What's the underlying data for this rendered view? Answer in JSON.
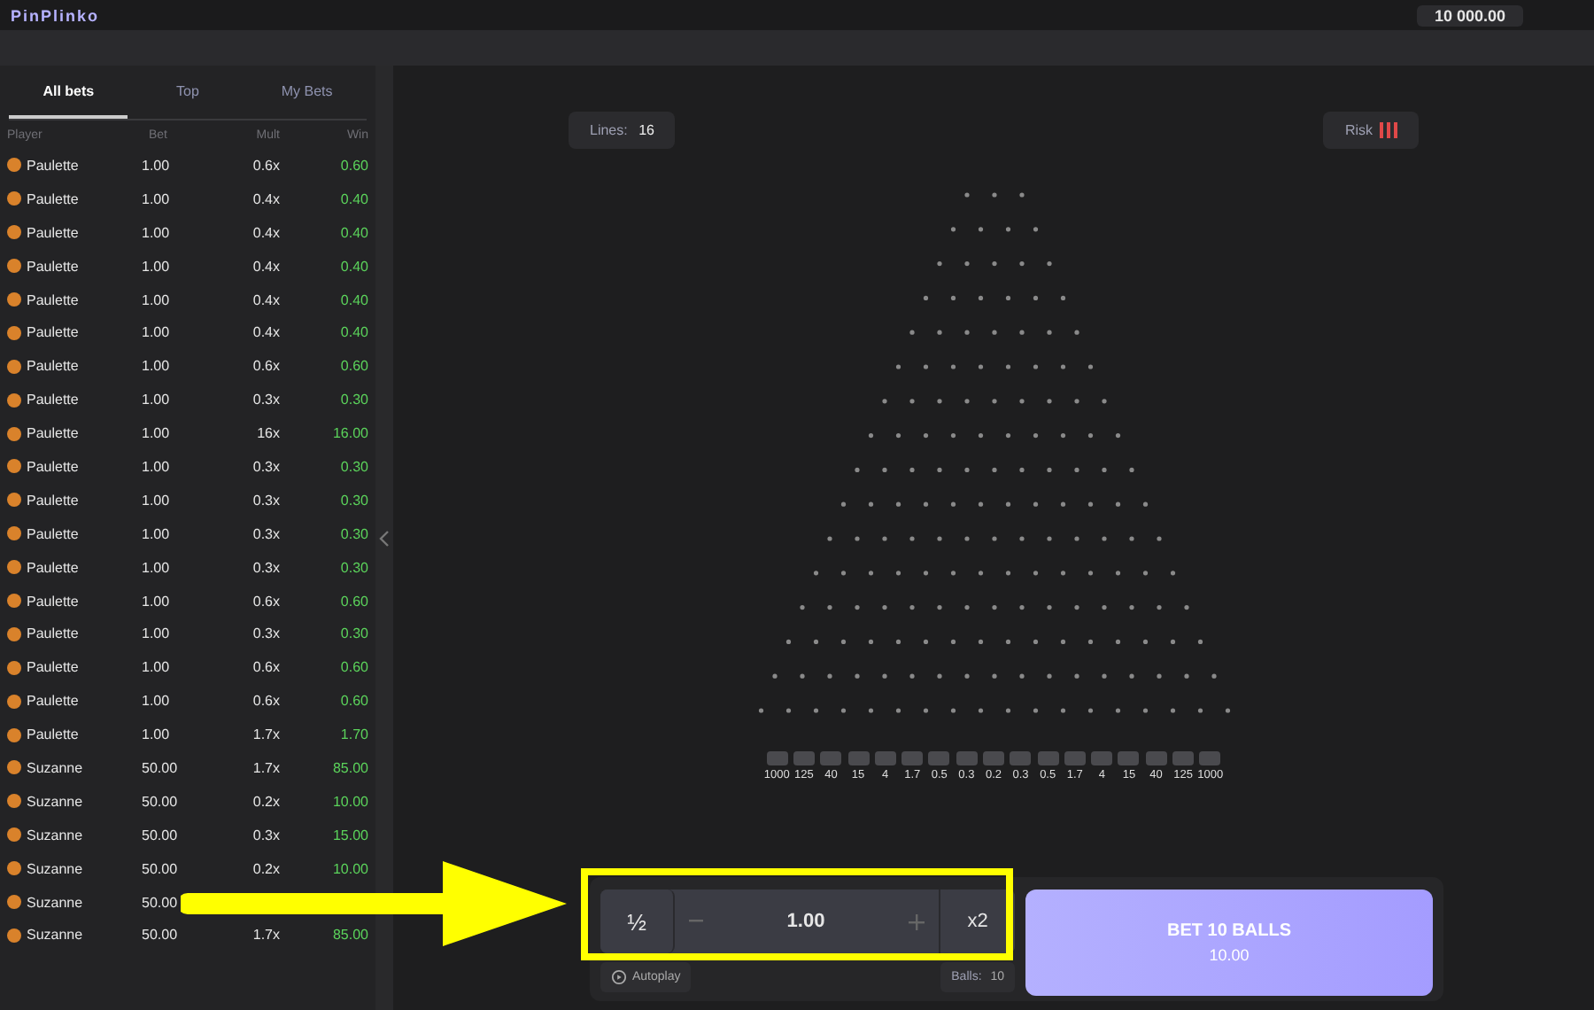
{
  "header": {
    "logo": "PinPlinko",
    "balance": "10 000.00"
  },
  "sidebar": {
    "tabs": [
      {
        "label": "All bets",
        "selected": true
      },
      {
        "label": "Top",
        "selected": false
      },
      {
        "label": "My Bets",
        "selected": false
      }
    ],
    "columns": [
      "Player",
      "Bet",
      "Mult",
      "Win"
    ],
    "rows": [
      {
        "player": "Paulette",
        "bet": "1.00",
        "mult": "0.6x",
        "win": "0.60"
      },
      {
        "player": "Paulette",
        "bet": "1.00",
        "mult": "0.4x",
        "win": "0.40"
      },
      {
        "player": "Paulette",
        "bet": "1.00",
        "mult": "0.4x",
        "win": "0.40"
      },
      {
        "player": "Paulette",
        "bet": "1.00",
        "mult": "0.4x",
        "win": "0.40"
      },
      {
        "player": "Paulette",
        "bet": "1.00",
        "mult": "0.4x",
        "win": "0.40"
      },
      {
        "player": "Paulette",
        "bet": "1.00",
        "mult": "0.4x",
        "win": "0.40"
      },
      {
        "player": "Paulette",
        "bet": "1.00",
        "mult": "0.6x",
        "win": "0.60"
      },
      {
        "player": "Paulette",
        "bet": "1.00",
        "mult": "0.3x",
        "win": "0.30"
      },
      {
        "player": "Paulette",
        "bet": "1.00",
        "mult": "16x",
        "win": "16.00"
      },
      {
        "player": "Paulette",
        "bet": "1.00",
        "mult": "0.3x",
        "win": "0.30"
      },
      {
        "player": "Paulette",
        "bet": "1.00",
        "mult": "0.3x",
        "win": "0.30"
      },
      {
        "player": "Paulette",
        "bet": "1.00",
        "mult": "0.3x",
        "win": "0.30"
      },
      {
        "player": "Paulette",
        "bet": "1.00",
        "mult": "0.3x",
        "win": "0.30"
      },
      {
        "player": "Paulette",
        "bet": "1.00",
        "mult": "0.6x",
        "win": "0.60"
      },
      {
        "player": "Paulette",
        "bet": "1.00",
        "mult": "0.3x",
        "win": "0.30"
      },
      {
        "player": "Paulette",
        "bet": "1.00",
        "mult": "0.6x",
        "win": "0.60"
      },
      {
        "player": "Paulette",
        "bet": "1.00",
        "mult": "0.6x",
        "win": "0.60"
      },
      {
        "player": "Paulette",
        "bet": "1.00",
        "mult": "1.7x",
        "win": "1.70"
      },
      {
        "player": "Suzanne",
        "bet": "50.00",
        "mult": "1.7x",
        "win": "85.00"
      },
      {
        "player": "Suzanne",
        "bet": "50.00",
        "mult": "0.2x",
        "win": "10.00"
      },
      {
        "player": "Suzanne",
        "bet": "50.00",
        "mult": "0.3x",
        "win": "15.00"
      },
      {
        "player": "Suzanne",
        "bet": "50.00",
        "mult": "0.2x",
        "win": "10.00"
      },
      {
        "player": "Suzanne",
        "bet": "50.00"
      },
      {
        "player": "Suzanne",
        "bet": "50.00",
        "mult": "1.7x",
        "win": "85.00"
      }
    ]
  },
  "game": {
    "lines_label": "Lines:",
    "lines": "16",
    "risk_label": "Risk",
    "multipliers": [
      "1000",
      "125",
      "40",
      "15",
      "4",
      "1.7",
      "0.5",
      "0.3",
      "0.2",
      "0.3",
      "0.5",
      "1.7",
      "4",
      "15",
      "40",
      "125",
      "1000"
    ]
  },
  "controls": {
    "half": "½",
    "amount": "1.00",
    "double": "x2",
    "bet_button": "BET 10 BALLS",
    "bet_total": "10.00",
    "autoplay": "Autoplay",
    "balls_label": "Balls:",
    "balls": "10"
  },
  "annotation": {
    "highlight": true
  }
}
